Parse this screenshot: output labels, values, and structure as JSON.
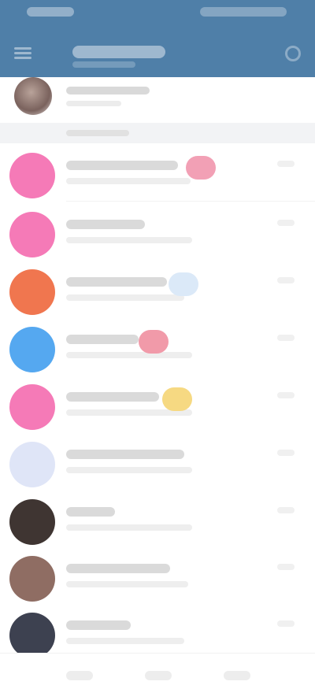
{
  "header": {
    "title": "",
    "subtitle": ""
  },
  "pinned": {
    "name": ""
  },
  "section": {
    "label": ""
  },
  "chats": [
    {
      "name": "",
      "avatar_color": "#f57ab7",
      "badge_color": "#f2a0b5"
    },
    {
      "name": "",
      "avatar_color": "#f57ab7",
      "badge_color": ""
    },
    {
      "name": "",
      "avatar_color": "#f0764f",
      "badge_color": "#dbe9f8"
    },
    {
      "name": "",
      "avatar_color": "#55a8f0",
      "badge_color": "#f19aa9"
    },
    {
      "name": "",
      "avatar_color": "#f57ab7",
      "badge_color": "#f6d982"
    },
    {
      "name": "",
      "avatar_color": "#dfe5f7",
      "badge_color": ""
    },
    {
      "name": "",
      "avatar_color": "#3f3532",
      "badge_color": ""
    },
    {
      "name": "",
      "avatar_color": "#8f6d63",
      "badge_color": ""
    },
    {
      "name": "",
      "avatar_color": "#3d4150",
      "badge_color": ""
    }
  ],
  "colors": {
    "header_bg": "#4f7fa8",
    "page_bg": "#ffffff",
    "divider_bg": "#f2f3f5"
  },
  "icons": {
    "menu": "menu-icon",
    "search": "search-icon"
  }
}
